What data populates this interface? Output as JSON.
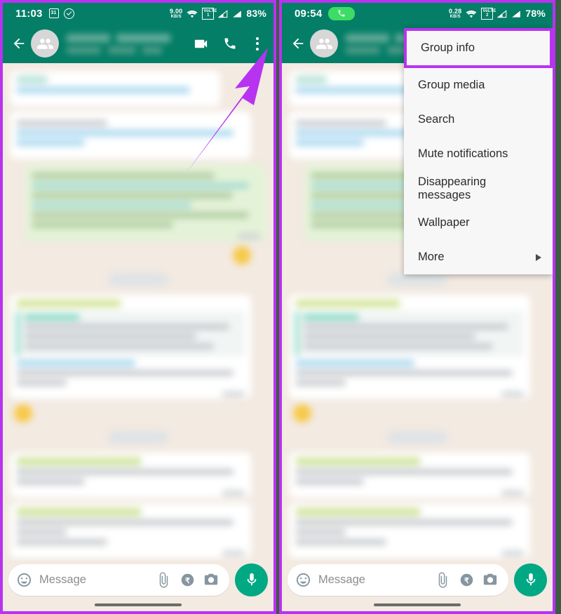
{
  "annotation": {
    "arrow_color": "#b833f0",
    "highlight_color": "#b833f0",
    "arrow_name": "purple-arrow-pointing-to-overflow-menu"
  },
  "theme": {
    "header_green": "#047e67",
    "chat_background": "#f3eae2",
    "outgoing_bubble": "#e4f3d8",
    "incoming_bubble": "#ffffff",
    "accent_green": "#00a884"
  },
  "panels": [
    {
      "id": "left",
      "status_bar": {
        "clock": "11:03",
        "left_icons": [
          "calendar-31-icon",
          "check-circle-icon"
        ],
        "data_rate_value": "9.00",
        "data_rate_unit": "KB/S",
        "wifi": "wifi-icon",
        "volte": "VoLTE",
        "volte_sim": "1",
        "signal_icons": [
          "signal-bars-icon",
          "signal-bars-icon"
        ],
        "battery": "83%"
      },
      "app_bar": {
        "back": "back-arrow-icon",
        "avatar": "group-avatar-icon",
        "title": "",
        "subtitle": "",
        "title_blurred": true,
        "actions": [
          "video-call-icon",
          "voice-call-icon",
          "overflow-menu-icon"
        ]
      },
      "menu_open": false,
      "input_bar": {
        "emoji": "emoji-icon",
        "placeholder": "Message",
        "attach": "paperclip-icon",
        "payment": "rupee-payment-icon",
        "camera": "camera-icon",
        "mic": "microphone-icon"
      }
    },
    {
      "id": "right",
      "status_bar": {
        "clock": "09:54",
        "left_icons": [
          "active-call-pill-icon"
        ],
        "data_rate_value": "0.28",
        "data_rate_unit": "KB/S",
        "wifi": "wifi-icon",
        "volte": "VoLTE",
        "volte_sim": "2",
        "signal_icons": [
          "signal-bars-icon",
          "signal-bars-icon"
        ],
        "battery": "78%"
      },
      "app_bar": {
        "back": "back-arrow-icon",
        "avatar": "group-avatar-icon",
        "title": "",
        "subtitle": "",
        "title_blurred": true,
        "actions": [
          "video-call-icon",
          "voice-call-icon",
          "overflow-menu-icon"
        ]
      },
      "menu_open": true,
      "input_bar": {
        "emoji": "emoji-icon",
        "placeholder": "Message",
        "attach": "paperclip-icon",
        "payment": "rupee-payment-icon",
        "camera": "camera-icon",
        "mic": "microphone-icon"
      }
    }
  ],
  "overflow_menu": {
    "items": [
      {
        "label": "Group info",
        "highlighted": true,
        "has_submenu": false
      },
      {
        "label": "Group media",
        "highlighted": false,
        "has_submenu": false
      },
      {
        "label": "Search",
        "highlighted": false,
        "has_submenu": false
      },
      {
        "label": "Mute notifications",
        "highlighted": false,
        "has_submenu": false
      },
      {
        "label": "Disappearing messages",
        "highlighted": false,
        "has_submenu": false
      },
      {
        "label": "Wallpaper",
        "highlighted": false,
        "has_submenu": false
      },
      {
        "label": "More",
        "highlighted": false,
        "has_submenu": true
      }
    ]
  }
}
